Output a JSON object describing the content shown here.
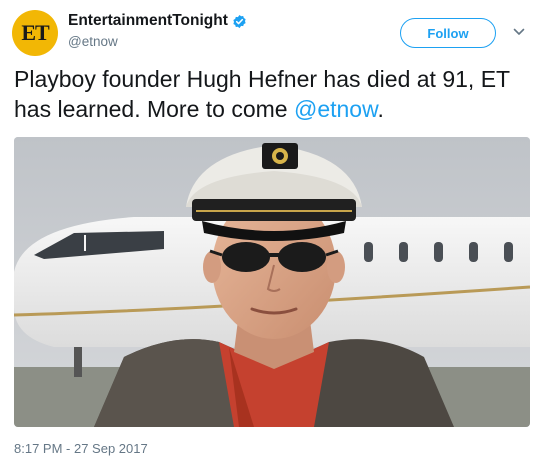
{
  "account": {
    "avatar_text": "ET",
    "display_name": "EntertainmentTonight",
    "handle": "@etnow",
    "verified": true
  },
  "follow_button": {
    "label": "Follow"
  },
  "tweet": {
    "text_before": "Playboy founder Hugh Hefner has died at 91, ET has learned. More to come ",
    "mention": "@etnow",
    "text_after": ".",
    "timestamp": "8:17 PM - 27 Sep 2017"
  },
  "icons": {
    "verified": "verified-badge-icon",
    "caret": "chevron-down-icon"
  },
  "colors": {
    "accent": "#1da1f2",
    "text": "#14171a",
    "secondary_text": "#657786",
    "avatar_bg": "#f2b705"
  }
}
